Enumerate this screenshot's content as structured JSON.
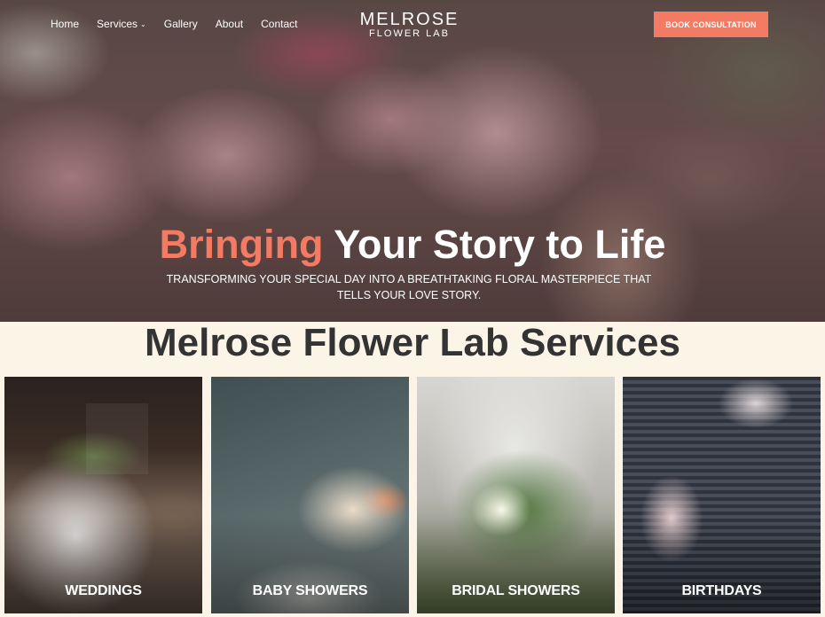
{
  "nav": {
    "items": [
      {
        "label": "Home",
        "active": true
      },
      {
        "label": "Services",
        "dropdown": true
      },
      {
        "label": "Gallery"
      },
      {
        "label": "About"
      },
      {
        "label": "Contact"
      }
    ],
    "dropdown_icon": "chevron-down-icon"
  },
  "logo": {
    "main": "MELROSE",
    "sub": "FLOWER LAB"
  },
  "cta": {
    "label": "BOOK CONSULTATION"
  },
  "hero": {
    "headline_accent": "Bringing",
    "headline_rest": " Your Story to Life",
    "subtitle": "TRANSFORMING YOUR SPECIAL DAY INTO A BREATHTAKING FLORAL MASTERPIECE THAT TELLS YOUR LOVE STORY."
  },
  "services": {
    "title": "Melrose Flower Lab Services",
    "cards": [
      {
        "label": "WEDDINGS"
      },
      {
        "label": "BABY SHOWERS"
      },
      {
        "label": "BRIDAL SHOWERS"
      },
      {
        "label": "BIRTHDAYS"
      }
    ]
  },
  "colors": {
    "accent": "#f47b63",
    "section_bg": "#fdf4e8",
    "title_text": "#333333"
  }
}
